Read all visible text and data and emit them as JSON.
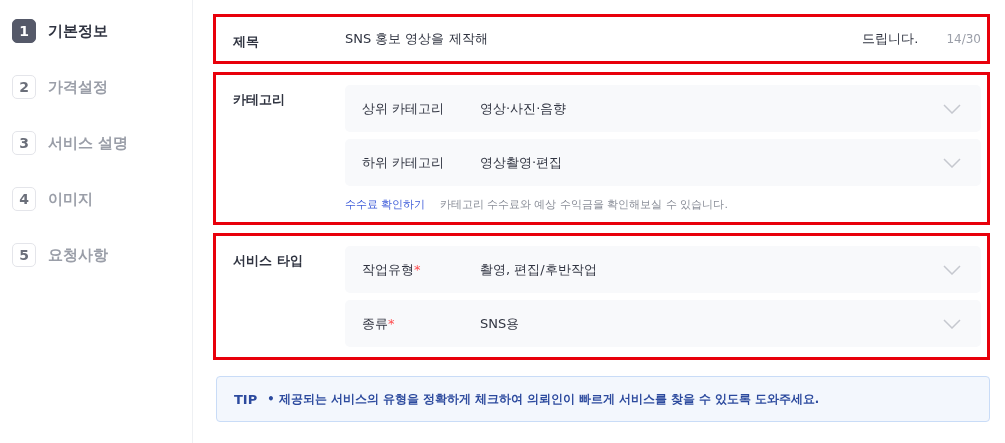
{
  "steps": [
    {
      "number": "1",
      "label": "기본정보",
      "selected": true
    },
    {
      "number": "2",
      "label": "가격설정",
      "selected": false
    },
    {
      "number": "3",
      "label": "서비스 설명",
      "selected": false
    },
    {
      "number": "4",
      "label": "이미지",
      "selected": false
    },
    {
      "number": "5",
      "label": "요청사항",
      "selected": false
    }
  ],
  "title_section": {
    "label": "제목",
    "value": "SNS 홍보 영상을 제작해",
    "suffix": "드립니다.",
    "counter": "14/30"
  },
  "category_section": {
    "label": "카테고리",
    "selects": [
      {
        "label": "상위 카테고리",
        "value": "영상·사진·음향"
      },
      {
        "label": "하위 카테고리",
        "value": "영상촬영·편집"
      }
    ],
    "link": "수수료 확인하기",
    "note": "카테고리 수수료와 예상 수익금을 확인해보실 수 있습니다."
  },
  "service_type_section": {
    "label": "서비스 타입",
    "selects": [
      {
        "label": "작업유형",
        "required_mark": "*",
        "value": "촬영, 편집/후반작업"
      },
      {
        "label": "종류",
        "required_mark": "*",
        "value": "SNS용"
      }
    ]
  },
  "tip": {
    "label": "TIP",
    "text": "• 제공되는 서비스의 유형을 정확하게 체크하여 의뢰인이 빠르게 서비스를 찾을 수 있도록 도와주세요."
  }
}
